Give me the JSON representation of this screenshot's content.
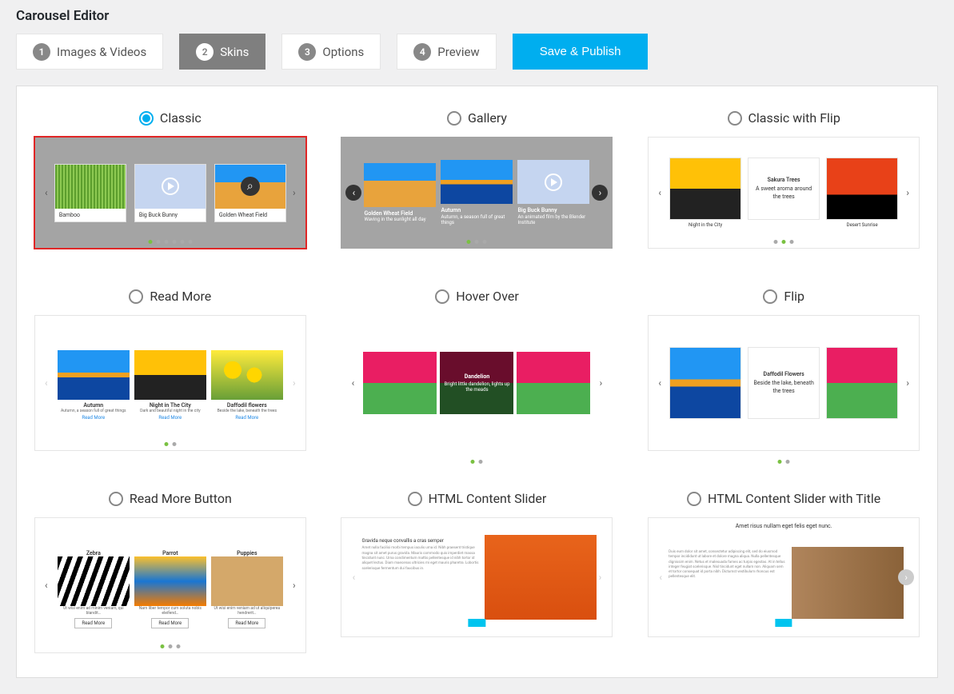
{
  "title": "Carousel Editor",
  "wizard": [
    {
      "num": "1",
      "label": "Images & Videos",
      "active": false
    },
    {
      "num": "2",
      "label": "Skins",
      "active": true
    },
    {
      "num": "3",
      "label": "Options",
      "active": false
    },
    {
      "num": "4",
      "label": "Preview",
      "active": false
    }
  ],
  "save_label": "Save & Publish",
  "skins": [
    {
      "name": "Classic",
      "checked": true,
      "selected": true,
      "items": [
        {
          "label": "Bamboo"
        },
        {
          "label": "Big Buck Bunny"
        },
        {
          "label": "Golden Wheat Field"
        }
      ]
    },
    {
      "name": "Gallery",
      "checked": false,
      "items": [
        {
          "title": "Golden Wheat Field",
          "sub": "Waving in the sunlight all day"
        },
        {
          "title": "Autumn",
          "sub": "Autumn, a season full of great things"
        },
        {
          "title": "Big Buck Bunny",
          "sub": "An animated film by the Blender Institute"
        }
      ]
    },
    {
      "name": "Classic with Flip",
      "checked": false,
      "items": [
        {
          "cap": "Night in the City"
        },
        {
          "title": "Sakura Trees",
          "sub": "A sweet aroma around the trees"
        },
        {
          "cap": "Desert Sunrise"
        }
      ]
    },
    {
      "name": "Read More",
      "checked": false,
      "items": [
        {
          "title": "Autumn",
          "sub": "Autumn, a season full of great things",
          "link": "Read More"
        },
        {
          "title": "Night in The City",
          "sub": "Dark and beautiful night in the city",
          "link": "Read More"
        },
        {
          "title": "Daffodil flowers",
          "sub": "Beside the lake, beneath the trees",
          "link": "Read More"
        }
      ]
    },
    {
      "name": "Hover Over",
      "checked": false,
      "items": [
        {},
        {
          "title": "Dandelion",
          "sub": "Bright little dandelion, lights up the meads"
        },
        {}
      ]
    },
    {
      "name": "Flip",
      "checked": false,
      "items": [
        {},
        {
          "title": "Daffodil Flowers",
          "sub": "Beside the lake, beneath the trees"
        },
        {}
      ]
    },
    {
      "name": "Read More Button",
      "checked": false,
      "items": [
        {
          "title": "Zebra",
          "sub": "Ut wisi enim ad minim veniam, qui blandit…",
          "btn": "Read More"
        },
        {
          "title": "Parrot",
          "sub": "Nam liber tempor cum soluta nobis eleifend…",
          "btn": "Read More"
        },
        {
          "title": "Puppies",
          "sub": "Ut wisi enim veniam ad ut aliquiperea hendrerit…",
          "btn": "Read More"
        }
      ]
    },
    {
      "name": "HTML Content Slider",
      "checked": false,
      "title": "Gravida neque convallis a cras semper",
      "lorem": "Amet nulla facilisi morbi tempus iaculis urna id. Nibh praesent tristique magna sit amet purus gravida. Mauris commodo quis imperdiet massa tincidunt nunc. Urna condimentum mattis pellentesque id nibh tortor id aliquet lectus. Diam maecenas ultricies mi eget mauris pharetra. Lobortis scelerisque fermentum dui faucibus in."
    },
    {
      "name": "HTML Content Slider with Title",
      "checked": false,
      "top_title": "Amet risus nullam eget felis eget nunc.",
      "lorem": "Duis eum dolor sit amet, consectetur adipiscing elit, sed do eiusmod tempor incididunt ut labore et dolore magna aliqua. Nulla pellentesque dignissim enim. Netus et malesuada fames ac turpis egestas. At in tellus integer feugiat scelerisque. Nisl tincidunt eget nullam non. Aliquam sem et tortor consequat id porta nibh. Dictumst vestibulum rhoncus est pellentesque elit."
    }
  ]
}
